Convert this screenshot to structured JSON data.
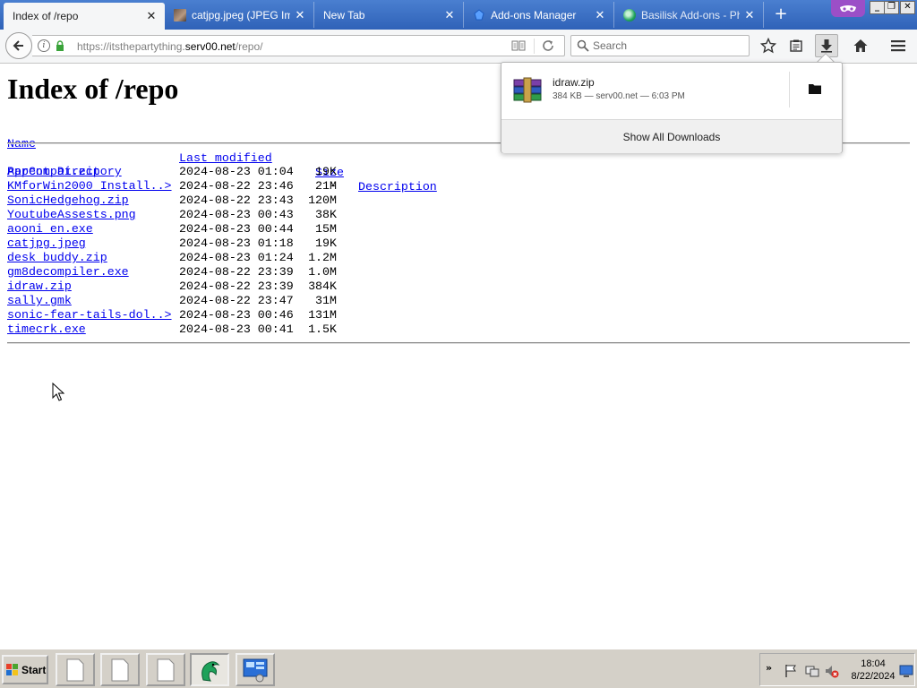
{
  "tabs": [
    {
      "title": "Index of /repo",
      "active": true,
      "favicon": "none"
    },
    {
      "title": "catjpg.jpeg (JPEG Ima",
      "active": false,
      "favicon": "image-thumbnail-icon"
    },
    {
      "title": "New Tab",
      "active": false,
      "favicon": "none"
    },
    {
      "title": "Add-ons Manager",
      "active": false,
      "favicon": "puzzle-icon"
    },
    {
      "title": "Basilisk Add-ons - Pha",
      "active": false,
      "favicon": "basilisk-icon"
    }
  ],
  "tab_close_glyph": "✕",
  "new_tab_glyph": "+",
  "window_controls": {
    "minimize": "_",
    "restore": "❐",
    "close": "✕"
  },
  "navbar": {
    "url_scheme_path_prefix": "https://itsthepartything.",
    "url_domain": "serv00.net",
    "url_path": "/repo/",
    "search_placeholder": "Search"
  },
  "page": {
    "heading": "Index of /repo",
    "columns": {
      "name": "Name",
      "modified": "Last modified",
      "size": "Size",
      "description": "Description"
    },
    "parent": {
      "name": "Parent Directory",
      "size": "-"
    },
    "files": [
      {
        "name": "AppCompat.zip",
        "modified": "2024-08-23 01:04",
        "size": "19K"
      },
      {
        "name": "KMforWin2000_Install..>",
        "modified": "2024-08-22 23:46",
        "size": "21M"
      },
      {
        "name": "SonicHedgehog.zip",
        "modified": "2024-08-22 23:43",
        "size": "120M"
      },
      {
        "name": "YoutubeAssests.png",
        "modified": "2024-08-23 00:43",
        "size": "38K"
      },
      {
        "name": "aooni_en.exe",
        "modified": "2024-08-23 00:44",
        "size": "15M"
      },
      {
        "name": "catjpg.jpeg",
        "modified": "2024-08-23 01:18",
        "size": "19K"
      },
      {
        "name": "desk_buddy.zip",
        "modified": "2024-08-23 01:24",
        "size": "1.2M"
      },
      {
        "name": "gm8decompiler.exe",
        "modified": "2024-08-22 23:39",
        "size": "1.0M"
      },
      {
        "name": "idraw.zip",
        "modified": "2024-08-22 23:39",
        "size": "384K"
      },
      {
        "name": "sally.gmk",
        "modified": "2024-08-22 23:47",
        "size": "31M"
      },
      {
        "name": "sonic-fear-tails-dol..>",
        "modified": "2024-08-23 00:46",
        "size": "131M"
      },
      {
        "name": "timecrk.exe",
        "modified": "2024-08-23 00:41",
        "size": "1.5K"
      }
    ]
  },
  "downloads_panel": {
    "item_name": "idraw.zip",
    "item_meta": "384 KB — serv00.net — 6:03 PM",
    "footer": "Show All Downloads"
  },
  "taskbar": {
    "start_label": "Start",
    "clock_time": "18:04",
    "clock_date": "8/22/2024",
    "tray_chevron": "»"
  },
  "colors": {
    "tabstrip": "#2f62b8",
    "link": "#0000ee",
    "taskbar": "#d4d0c8",
    "private_mask": "#9b4fc7"
  }
}
